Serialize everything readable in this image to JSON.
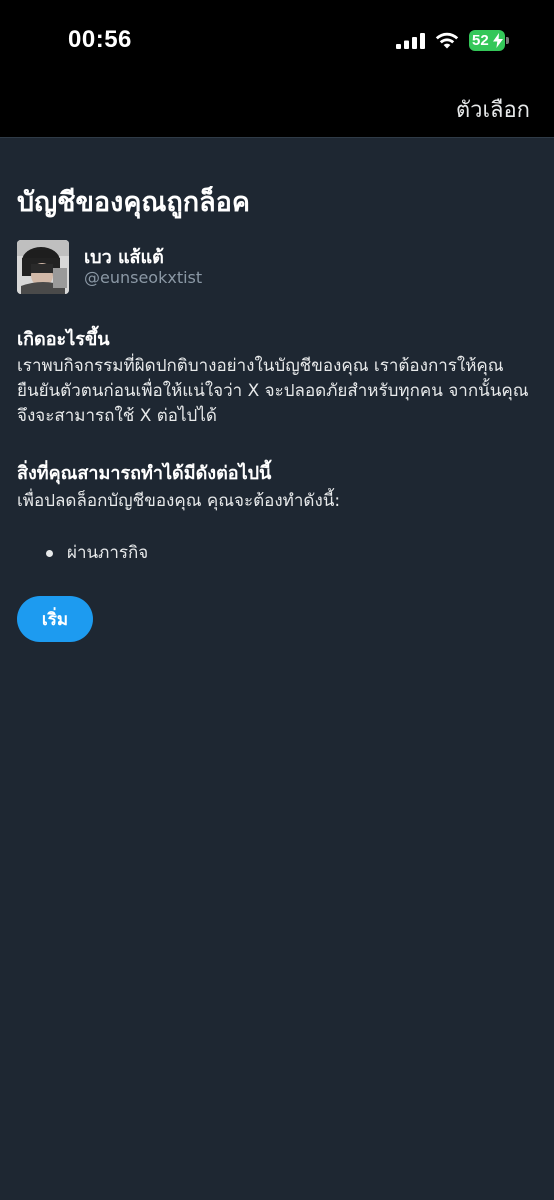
{
  "status_bar": {
    "time": "00:56",
    "battery": "52",
    "battery_color": "#34c759"
  },
  "nav": {
    "options_label": "ตัวเลือก"
  },
  "main": {
    "title": "บัญชีของคุณถูกล็อค",
    "user": {
      "name": "เบว แส้แต้",
      "handle": "@eunseokxtist"
    },
    "section1": {
      "heading": "เกิดอะไรขึ้น",
      "body": "เราพบกิจกรรมที่ผิดปกติบางอย่างในบัญชีของคุณ เราต้องการให้คุณยืนยันตัวตนก่อนเพื่อให้แน่ใจว่า X จะปลอดภัยสำหรับทุกคน จากนั้นคุณจึงจะสามารถใช้ X ต่อไปได้"
    },
    "section2": {
      "heading": "สิ่งที่คุณสามารถทำได้มีดังต่อไปนี้",
      "body": "เพื่อปลดล็อกบัญชีของคุณ คุณจะต้องทำดังนี้:",
      "items": [
        "ผ่านภารกิจ"
      ]
    },
    "start_button_label": "เริ่ม",
    "accent_color": "#1d9bf0"
  }
}
